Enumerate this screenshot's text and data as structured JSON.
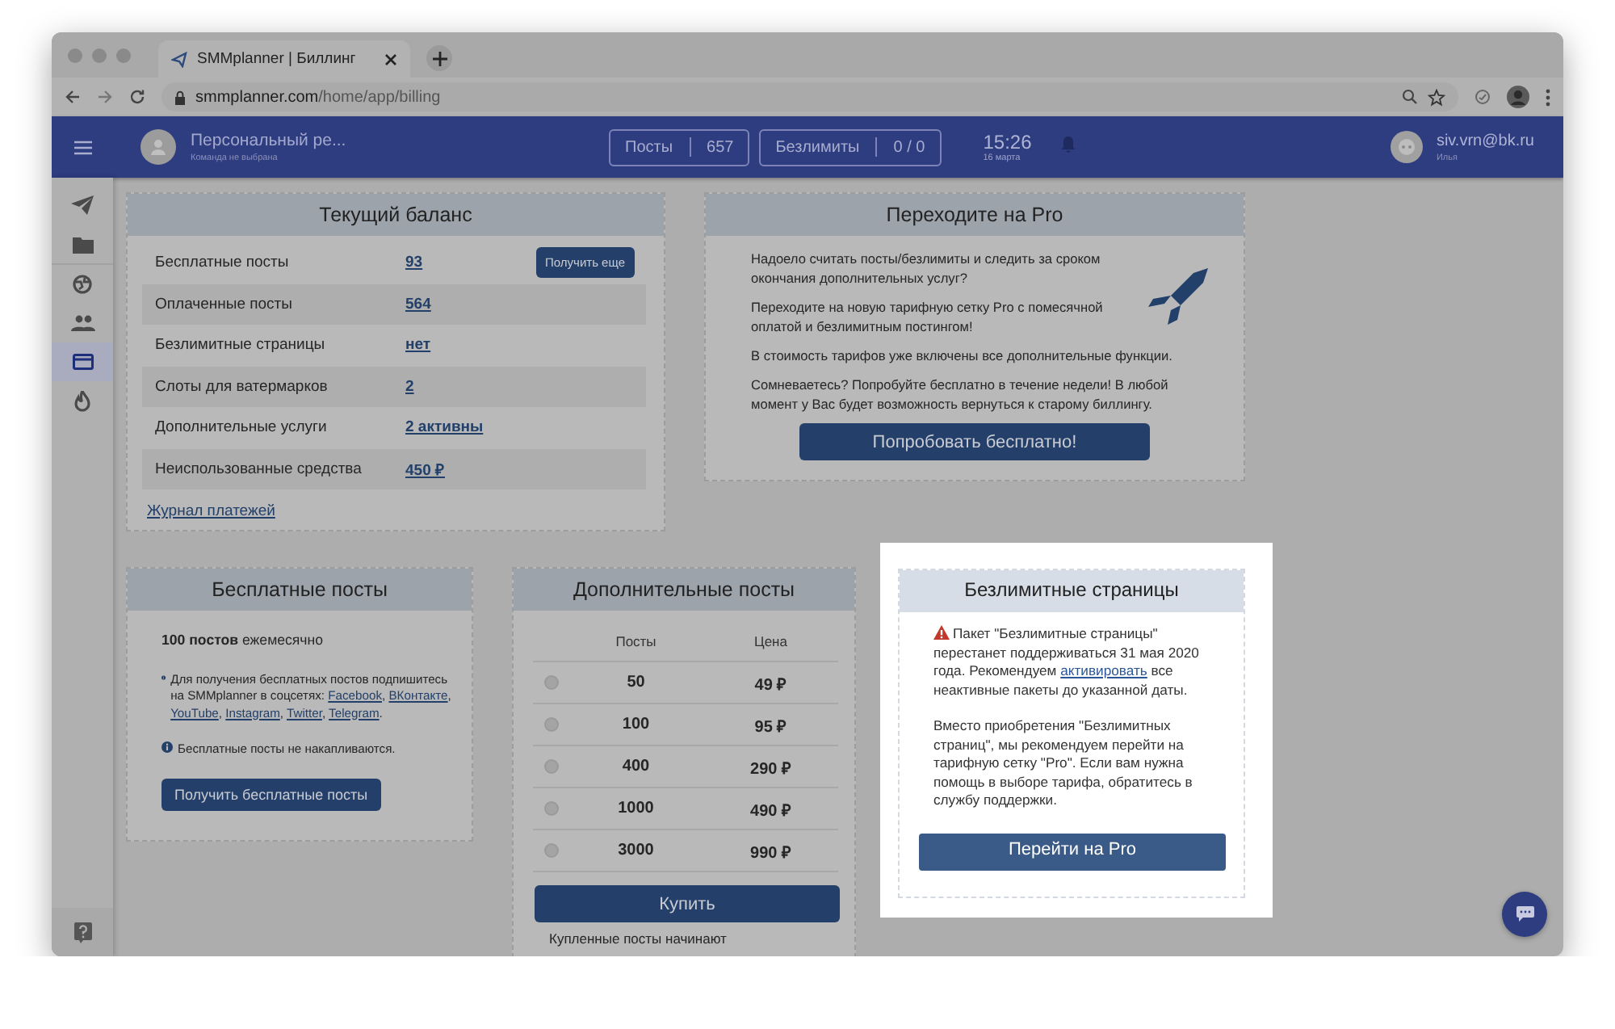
{
  "browser": {
    "tab_title": "SMMplanner | Биллинг",
    "url_host": "smmplanner.com",
    "url_path": "/home/app/billing"
  },
  "header": {
    "workspace": "Персональный ре...",
    "workspace_note": "Команда не выбрана",
    "counters": [
      {
        "label": "Посты",
        "value": "657"
      },
      {
        "label": "Безлимиты",
        "value": "0 / 0"
      }
    ],
    "time": "15:26",
    "date": "16 марта",
    "user_email": "siv.vrn@bk.ru",
    "user_name": "Илья"
  },
  "sidebar": {
    "items": [
      {
        "kind": "send",
        "selected": false
      },
      {
        "kind": "folder",
        "selected": false
      },
      {
        "kind": "globe",
        "selected": false
      },
      {
        "kind": "people",
        "selected": false
      },
      {
        "kind": "card",
        "selected": true
      },
      {
        "kind": "fire",
        "selected": false
      }
    ]
  },
  "balance": {
    "title": "Текущий баланс",
    "rows": [
      {
        "label": "Бесплатные посты",
        "value": "93",
        "action": "Получить еще"
      },
      {
        "label": "Оплаченные посты",
        "value": "564"
      },
      {
        "label": "Безлимитные страницы",
        "value": "нет"
      },
      {
        "label": "Слоты для ватермарков",
        "value": "2"
      },
      {
        "label": "Дополнительные услуги",
        "value": "2 активны"
      },
      {
        "label": "Неиспользованные средства",
        "value": "450 ₽"
      }
    ],
    "link": "Журнал платежей"
  },
  "pro": {
    "title": "Переходите на Pro",
    "paragraphs": [
      "Надоело считать посты/безлимиты и следить за сроком окончания дополнительных услуг?",
      "Переходите на новую тарифную сетку Pro с помесячной оплатой и безлимитным постингом!",
      "В стоимость тарифов уже включены все дополнительные функции.",
      "Сомневаетесь? Попробуйте бесплатно в течение недели! В любой момент у Вас будет возможность вернуться к старому биллингу."
    ],
    "button": "Попробовать бесплатно!"
  },
  "free": {
    "title": "Бесплатные посты",
    "lead": "**100 постов** ежемесячно",
    "info": "Для получения бесплатных постов подпишитесь на SMMplanner в соцсетях:",
    "links": [
      {
        "text": "Facebook",
        "after": ", "
      },
      {
        "text": "ВКонтакте",
        "after": ", "
      },
      {
        "text": "YouTube",
        "after": ", "
      },
      {
        "text": "Instagram",
        "after": ", "
      },
      {
        "text": "Twitter",
        "after": ", "
      },
      {
        "text": "Telegram",
        "after": "."
      }
    ],
    "note": "Бесплатные посты не накапливаются.",
    "button": "Получить бесплатные посты"
  },
  "extra": {
    "title": "Дополнительные посты",
    "columns": [
      "Посты",
      "Цена"
    ],
    "rows": [
      {
        "posts": "50",
        "price": "49 ₽",
        "selected": false
      },
      {
        "posts": "100",
        "price": "95 ₽",
        "selected": false
      },
      {
        "posts": "400",
        "price": "290 ₽",
        "selected": false
      },
      {
        "posts": "1000",
        "price": "490 ₽",
        "selected": false
      },
      {
        "posts": "3000",
        "price": "990 ₽",
        "selected": false
      }
    ],
    "button": "Купить",
    "note": "Купленные посты начинают"
  },
  "unlimited": {
    "title": "Безлимитные страницы",
    "warning_before": "Пакет \"Безлимитные страницы\" перестанет поддерживаться 31 мая 2020 года. Рекомендуем ",
    "warning_link": "активировать",
    "warning_after": " все неактивные пакеты до указанной даты.",
    "text": "Вместо приобретения \"Безлимитных страниц\", мы рекомендуем перейти на тарифную сетку \"Pro\". Если вам нужна помощь в выборе тарифа, обратитесь в службу поддержки.",
    "button": "Перейти на Pro"
  }
}
